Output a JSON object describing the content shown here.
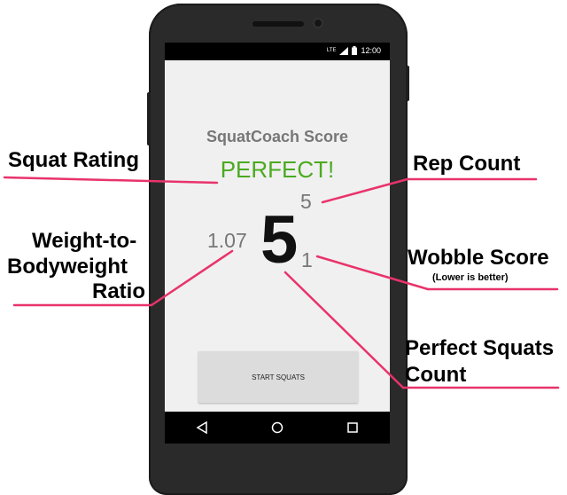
{
  "colors": {
    "accent_line": "#e8336b",
    "rating_green": "#4aaa1f",
    "muted_gray": "#777777",
    "phone_body": "#2a2a2a"
  },
  "status_bar": {
    "network": "LTE",
    "time": "12:00"
  },
  "app": {
    "title": "SquatCoach Score",
    "rating": "PERFECT!",
    "perfect_squats": "5",
    "weight_ratio": "1.07",
    "rep_count": "5",
    "wobble_score": "1",
    "start_button_label": "START SQUATS"
  },
  "nav_bar": {
    "back_icon": "triangle-back-icon",
    "home_icon": "circle-home-icon",
    "recents_icon": "square-recents-icon"
  },
  "annotations": {
    "squat_rating": "Squat Rating",
    "rep_count": "Rep Count",
    "weight_ratio_line1": "Weight-to-",
    "weight_ratio_line2": "Bodyweight",
    "weight_ratio_line3": "Ratio",
    "wobble_score": "Wobble Score",
    "wobble_note": "(Lower is better)",
    "perfect_squats_line1": "Perfect Squats",
    "perfect_squats_line2": "Count"
  }
}
